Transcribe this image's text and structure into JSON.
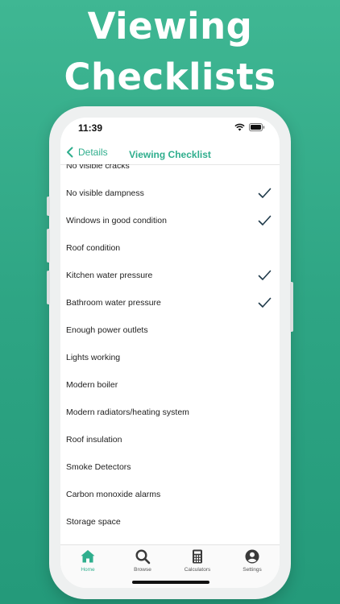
{
  "headline": {
    "line1": "Viewing",
    "line2": "Checklists"
  },
  "status_bar": {
    "time": "11:39"
  },
  "nav": {
    "back_label": "Details",
    "title": "Viewing Checklist"
  },
  "colors": {
    "accent": "#2fae8d",
    "check": "#1f3a4a",
    "background_top": "#3fb793",
    "background_bottom": "#249a7a"
  },
  "checklist": [
    {
      "label": "No visible cracks",
      "checked": false
    },
    {
      "label": "No visible dampness",
      "checked": true
    },
    {
      "label": "Windows in good condition",
      "checked": true
    },
    {
      "label": "Roof condition",
      "checked": false
    },
    {
      "label": "Kitchen water pressure",
      "checked": true
    },
    {
      "label": "Bathroom water pressure",
      "checked": true
    },
    {
      "label": "Enough power outlets",
      "checked": false
    },
    {
      "label": "Lights working",
      "checked": false
    },
    {
      "label": "Modern boiler",
      "checked": false
    },
    {
      "label": "Modern radiators/heating system",
      "checked": false
    },
    {
      "label": "Roof insulation",
      "checked": false
    },
    {
      "label": "Smoke Detectors",
      "checked": false
    },
    {
      "label": "Carbon monoxide alarms",
      "checked": false
    },
    {
      "label": "Storage space",
      "checked": false
    }
  ],
  "tabs": [
    {
      "label": "Home",
      "icon": "home-icon",
      "active": true
    },
    {
      "label": "Browse",
      "icon": "search-icon",
      "active": false
    },
    {
      "label": "Calculators",
      "icon": "calculator-icon",
      "active": false
    },
    {
      "label": "Settings",
      "icon": "user-icon",
      "active": false
    }
  ]
}
